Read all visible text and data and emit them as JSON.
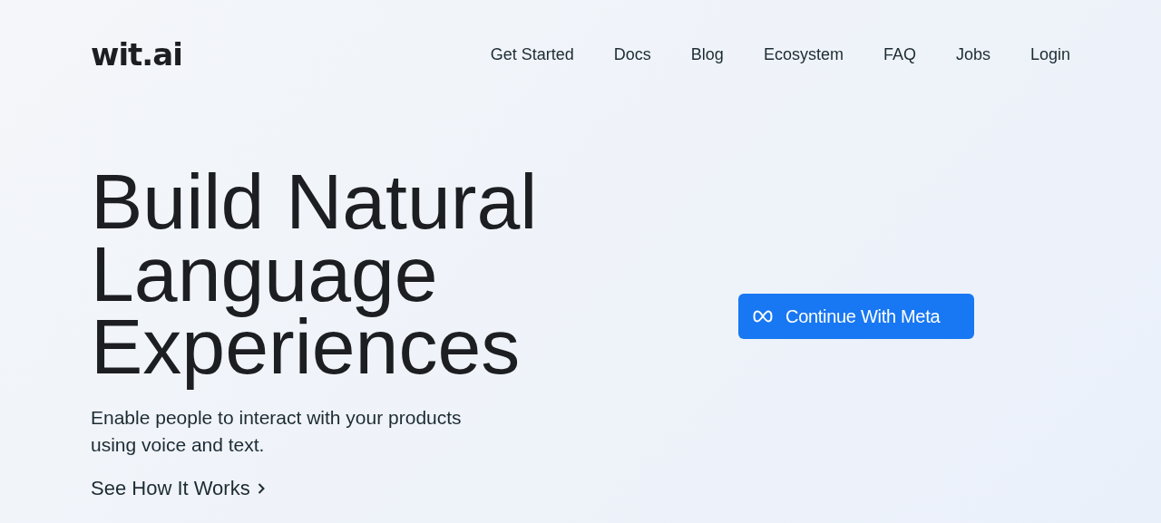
{
  "logo": "wit.ai",
  "nav": [
    "Get Started",
    "Docs",
    "Blog",
    "Ecosystem",
    "FAQ",
    "Jobs",
    "Login"
  ],
  "hero": {
    "title_lines": [
      "Build Natural",
      "Language",
      "Experiences"
    ],
    "subtitle": "Enable people to interact with your products using voice and text.",
    "link": "See How It Works"
  },
  "cta": {
    "label": "Continue With Meta"
  }
}
